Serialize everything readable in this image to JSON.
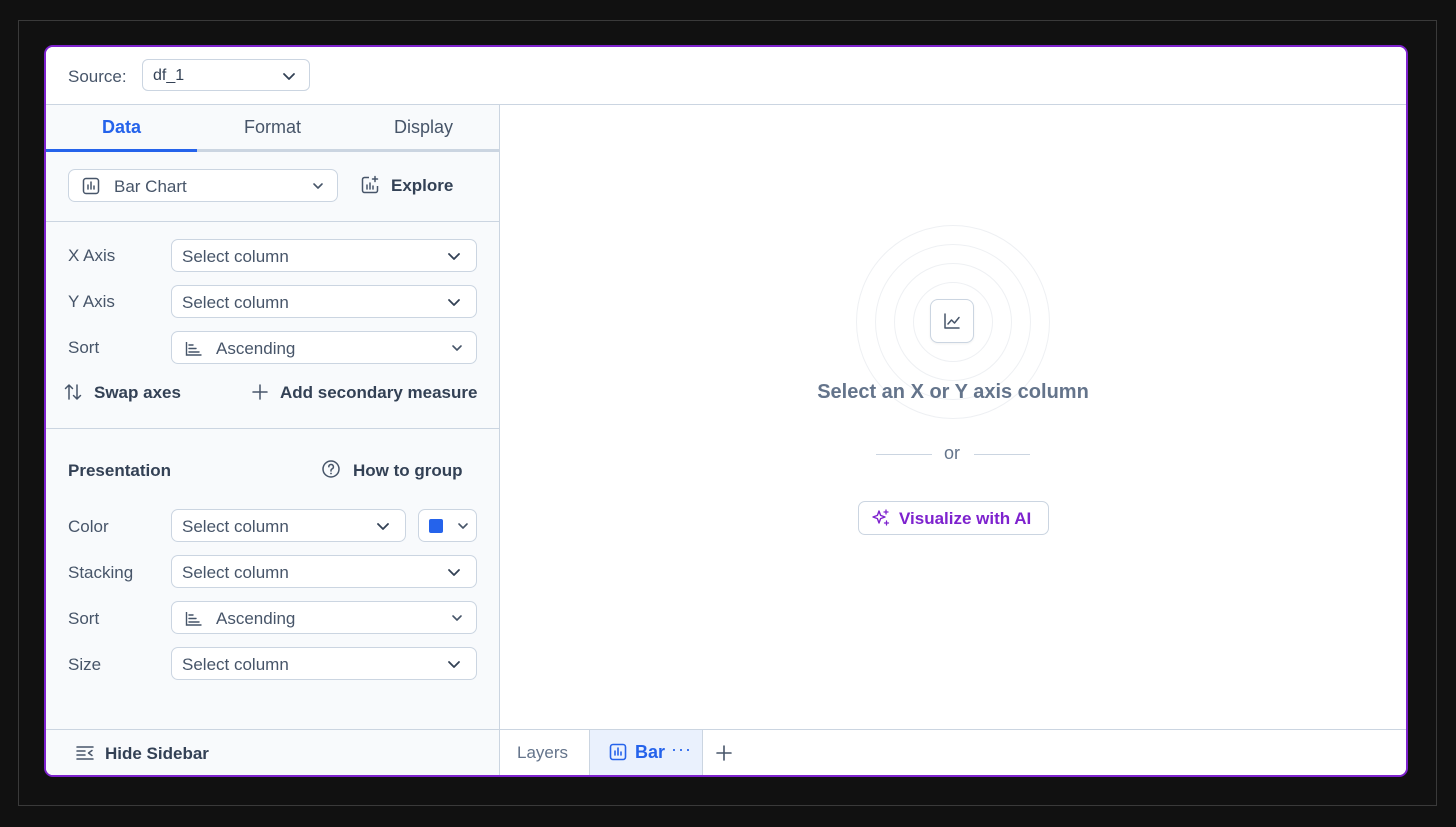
{
  "source": {
    "label": "Source:",
    "value": "df_1"
  },
  "tabs": [
    {
      "label": "Data",
      "active": true
    },
    {
      "label": "Format",
      "active": false
    },
    {
      "label": "Display",
      "active": false
    }
  ],
  "chart_type": {
    "value": "Bar Chart",
    "icon": "bar-chart-icon"
  },
  "explore": {
    "label": "Explore",
    "icon": "chart-plus-icon"
  },
  "axes": {
    "x": {
      "label": "X Axis",
      "placeholder": "Select column"
    },
    "y": {
      "label": "Y Axis",
      "placeholder": "Select column"
    },
    "sort": {
      "label": "Sort",
      "value": "Ascending"
    }
  },
  "actions": {
    "swap": "Swap axes",
    "secondary": "Add secondary measure"
  },
  "presentation": {
    "title": "Presentation",
    "help": "How to group",
    "color": {
      "label": "Color",
      "placeholder": "Select column",
      "swatch": "#2563eb"
    },
    "stacking": {
      "label": "Stacking",
      "placeholder": "Select column"
    },
    "sort": {
      "label": "Sort",
      "value": "Ascending"
    },
    "size": {
      "label": "Size",
      "placeholder": "Select column"
    }
  },
  "sidebar_footer": {
    "hide": "Hide Sidebar"
  },
  "empty_state": {
    "title": "Select an X or Y axis column",
    "or": "or",
    "ai_button": "Visualize with AI"
  },
  "bottombar": {
    "layers": "Layers",
    "active_layer": "Bar",
    "more": "···"
  },
  "colors": {
    "accent": "#2563eb",
    "ai": "#7e22ce",
    "frame": "#7e22ce"
  }
}
